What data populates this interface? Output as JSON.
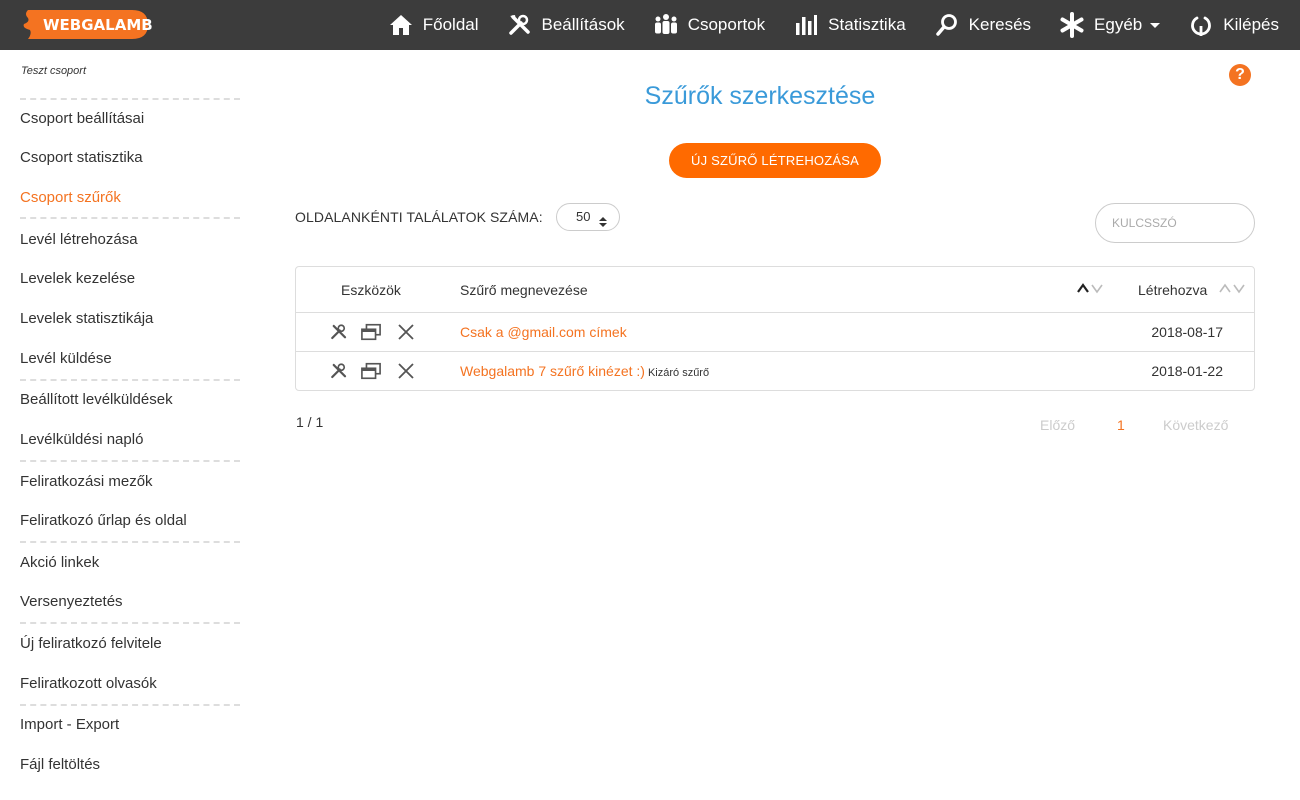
{
  "brand": {
    "logo_text": "WEBGALAMB"
  },
  "nav": [
    {
      "label": "Főoldal",
      "icon": "home-icon"
    },
    {
      "label": "Beállítások",
      "icon": "tools-icon"
    },
    {
      "label": "Csoportok",
      "icon": "group-icon"
    },
    {
      "label": "Statisztika",
      "icon": "bar-chart-icon"
    },
    {
      "label": "Keresés",
      "icon": "search-icon"
    },
    {
      "label": "Egyéb",
      "icon": "asterisk-icon"
    },
    {
      "label": "Kilépés",
      "icon": "logout-icon"
    }
  ],
  "sidebar": {
    "title": "Teszt csoport",
    "items": [
      {
        "label": "Csoport beállításai"
      },
      {
        "label": "Csoport statisztika"
      },
      {
        "label": "Csoport szűrők"
      },
      {
        "label": "Levél létrehozása"
      },
      {
        "label": "Levelek kezelése"
      },
      {
        "label": "Levelek statisztikája"
      },
      {
        "label": "Levél küldése"
      },
      {
        "label": "Beállított levélküldések"
      },
      {
        "label": "Levélküldési napló"
      },
      {
        "label": "Feliratkozási mezők"
      },
      {
        "label": "Feliratkozó űrlap és oldal"
      },
      {
        "label": "Akció linkek"
      },
      {
        "label": "Versenyeztetés"
      },
      {
        "label": "Új feliratkozó felvitele"
      },
      {
        "label": "Feliratkozott olvasók"
      },
      {
        "label": "Import - Export"
      },
      {
        "label": "Fájl feltöltés"
      }
    ]
  },
  "main": {
    "help": "?",
    "title": "Szűrők szerkesztése",
    "new_button": "ÚJ SZŰRŐ LÉTREHOZÁSA",
    "perpage_label": "OLDALANKÉNTI TALÁLATOK SZÁMA:",
    "perpage_value": "50",
    "keyword_placeholder": "KULCSSZÓ",
    "table": {
      "headers": {
        "tools": "Eszközök",
        "name": "Szűrő megnevezése",
        "created": "Létrehozva"
      },
      "rows": [
        {
          "name": "Csak a @gmail.com címek",
          "tag": "",
          "date": "2018-08-17"
        },
        {
          "name": "Webgalamb 7 szűrő kinézet :)",
          "tag": "Kizáró szűrő",
          "date": "2018-01-22"
        }
      ]
    },
    "page_count": "1 / 1",
    "pager": {
      "prev": "Előző",
      "current": "1",
      "next": "Következő"
    }
  },
  "colors": {
    "accent": "#f47321",
    "title_blue": "#3a9ad9",
    "navbar": "#3c3c3c"
  }
}
